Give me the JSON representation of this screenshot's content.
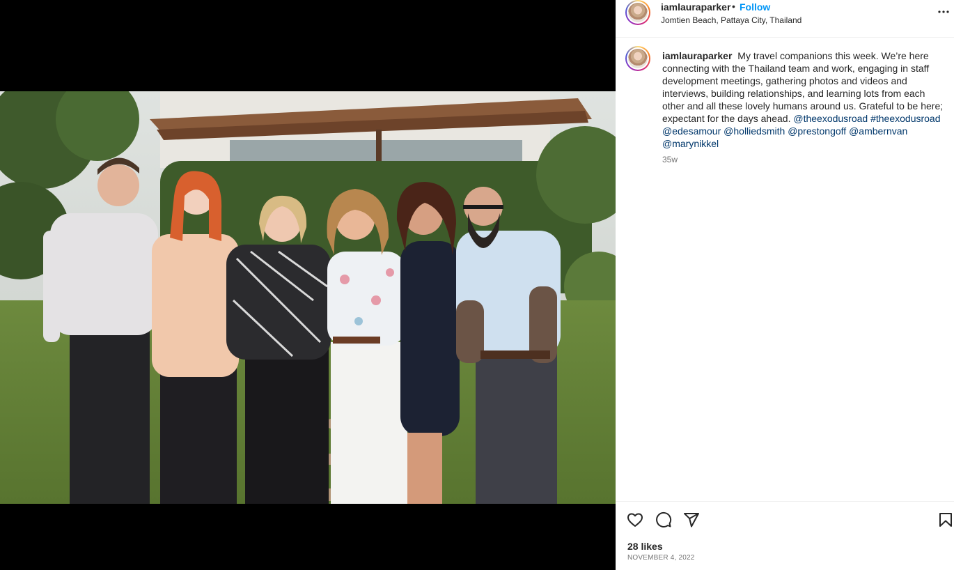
{
  "post": {
    "username": "iamlauraparker",
    "separator": "•",
    "follow_label": "Follow",
    "location": "Jomtien Beach, Pattaya City, Thailand"
  },
  "caption": {
    "username": "iamlauraparker",
    "text": "My travel companions this week. We’re here connecting with the Thailand team and work, engaging in staff development meetings, gathering photos and videos and interviews, building relationships, and learning lots from each other and all these lovely humans around us. Grateful to be here; expectant for the days ahead.",
    "tags": [
      "@theexodusroad",
      "#theexodusroad",
      "@edesamour",
      "@holliedsmith",
      "@prestongoff",
      "@ambernvan",
      "@marynikkel"
    ],
    "age": "35w"
  },
  "engagement": {
    "likes": "28 likes",
    "date": "NOVEMBER 4, 2022"
  },
  "icons": {
    "more": "more-options-icon",
    "like": "heart-icon",
    "comment": "comment-icon",
    "share": "share-icon",
    "save": "bookmark-icon"
  },
  "colors": {
    "accent": "#0095f6",
    "link": "#00376b",
    "muted": "#737373",
    "text": "#262626"
  }
}
